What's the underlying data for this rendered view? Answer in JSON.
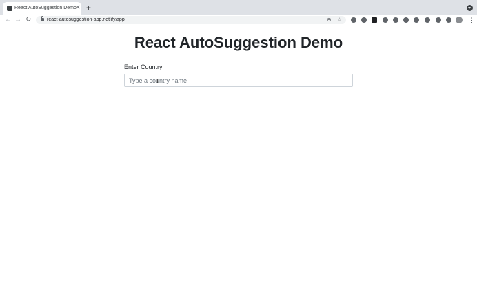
{
  "browser": {
    "tab": {
      "title": "React AutoSuggestion Demo",
      "close_glyph": "✕"
    },
    "new_tab_glyph": "+",
    "nav": {
      "back_glyph": "←",
      "forward_glyph": "→",
      "reload_glyph": "↻"
    },
    "url": "react-autosuggestion-app.netlify.app",
    "omnibox_icons": {
      "zoom_glyph": "⊕",
      "star_glyph": "☆"
    },
    "menu_glyph": "⋮"
  },
  "page": {
    "title": "React AutoSuggestion Demo",
    "country_field": {
      "label": "Enter Country",
      "placeholder": "Type a country name",
      "value": ""
    },
    "cursor_glyph": "I"
  }
}
